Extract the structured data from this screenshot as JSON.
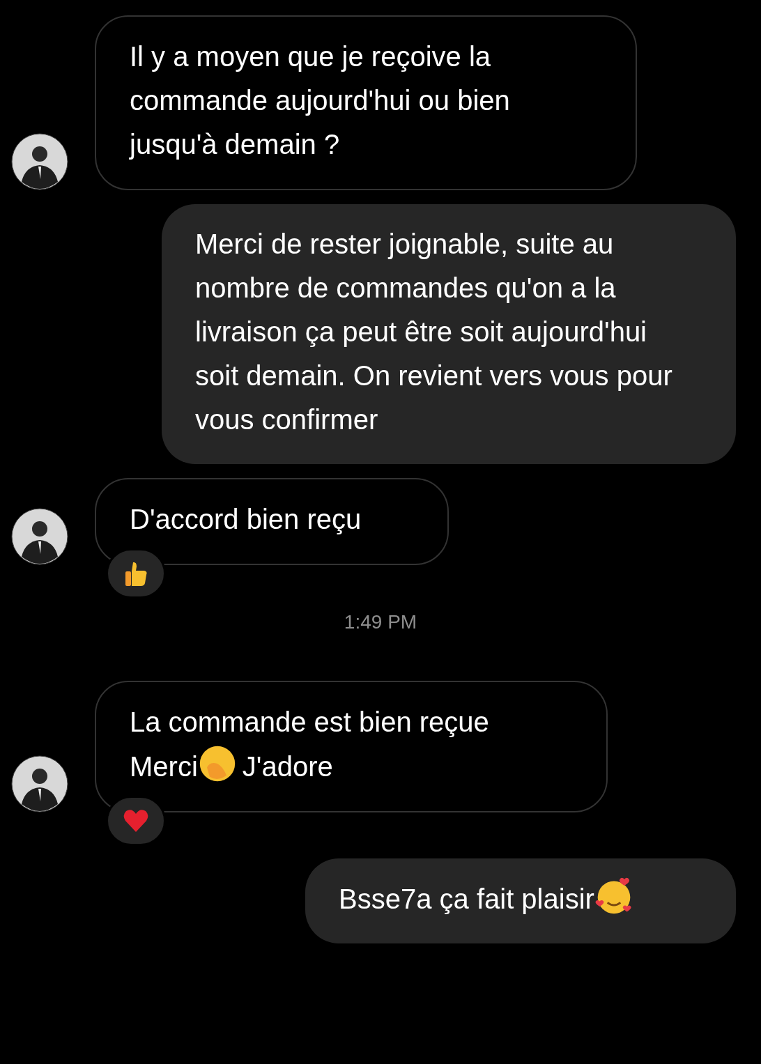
{
  "messages": [
    {
      "kind": "incoming",
      "parts": [
        {
          "kind": "text",
          "text": "Il y a moyen que je reçoive la commande aujourd'hui ou bien jusqu'à demain ?"
        }
      ]
    },
    {
      "kind": "outgoing",
      "parts": [
        {
          "kind": "text",
          "text": "Merci de rester joignable, suite au nombre de commandes qu'on a la livraison ça peut être soit aujourd'hui soit demain. On revient vers vous pour vous confirmer"
        }
      ]
    },
    {
      "kind": "incoming",
      "parts": [
        {
          "kind": "text",
          "text": "D'accord bien reçu"
        }
      ],
      "reaction": {
        "kind": "thumbs"
      }
    },
    {
      "kind": "timestamp",
      "text": "1:49 PM"
    },
    {
      "kind": "incoming",
      "parts": [
        {
          "kind": "text",
          "text": "La commande est bien reçue Merci"
        },
        {
          "kind": "hand"
        },
        {
          "kind": "text",
          "text": "J'adore"
        }
      ],
      "reaction": {
        "kind": "heart"
      }
    },
    {
      "kind": "outgoing",
      "parts": [
        {
          "kind": "text",
          "text": "Bsse7a ça fait plaisir"
        },
        {
          "kind": "hearts"
        }
      ]
    }
  ]
}
